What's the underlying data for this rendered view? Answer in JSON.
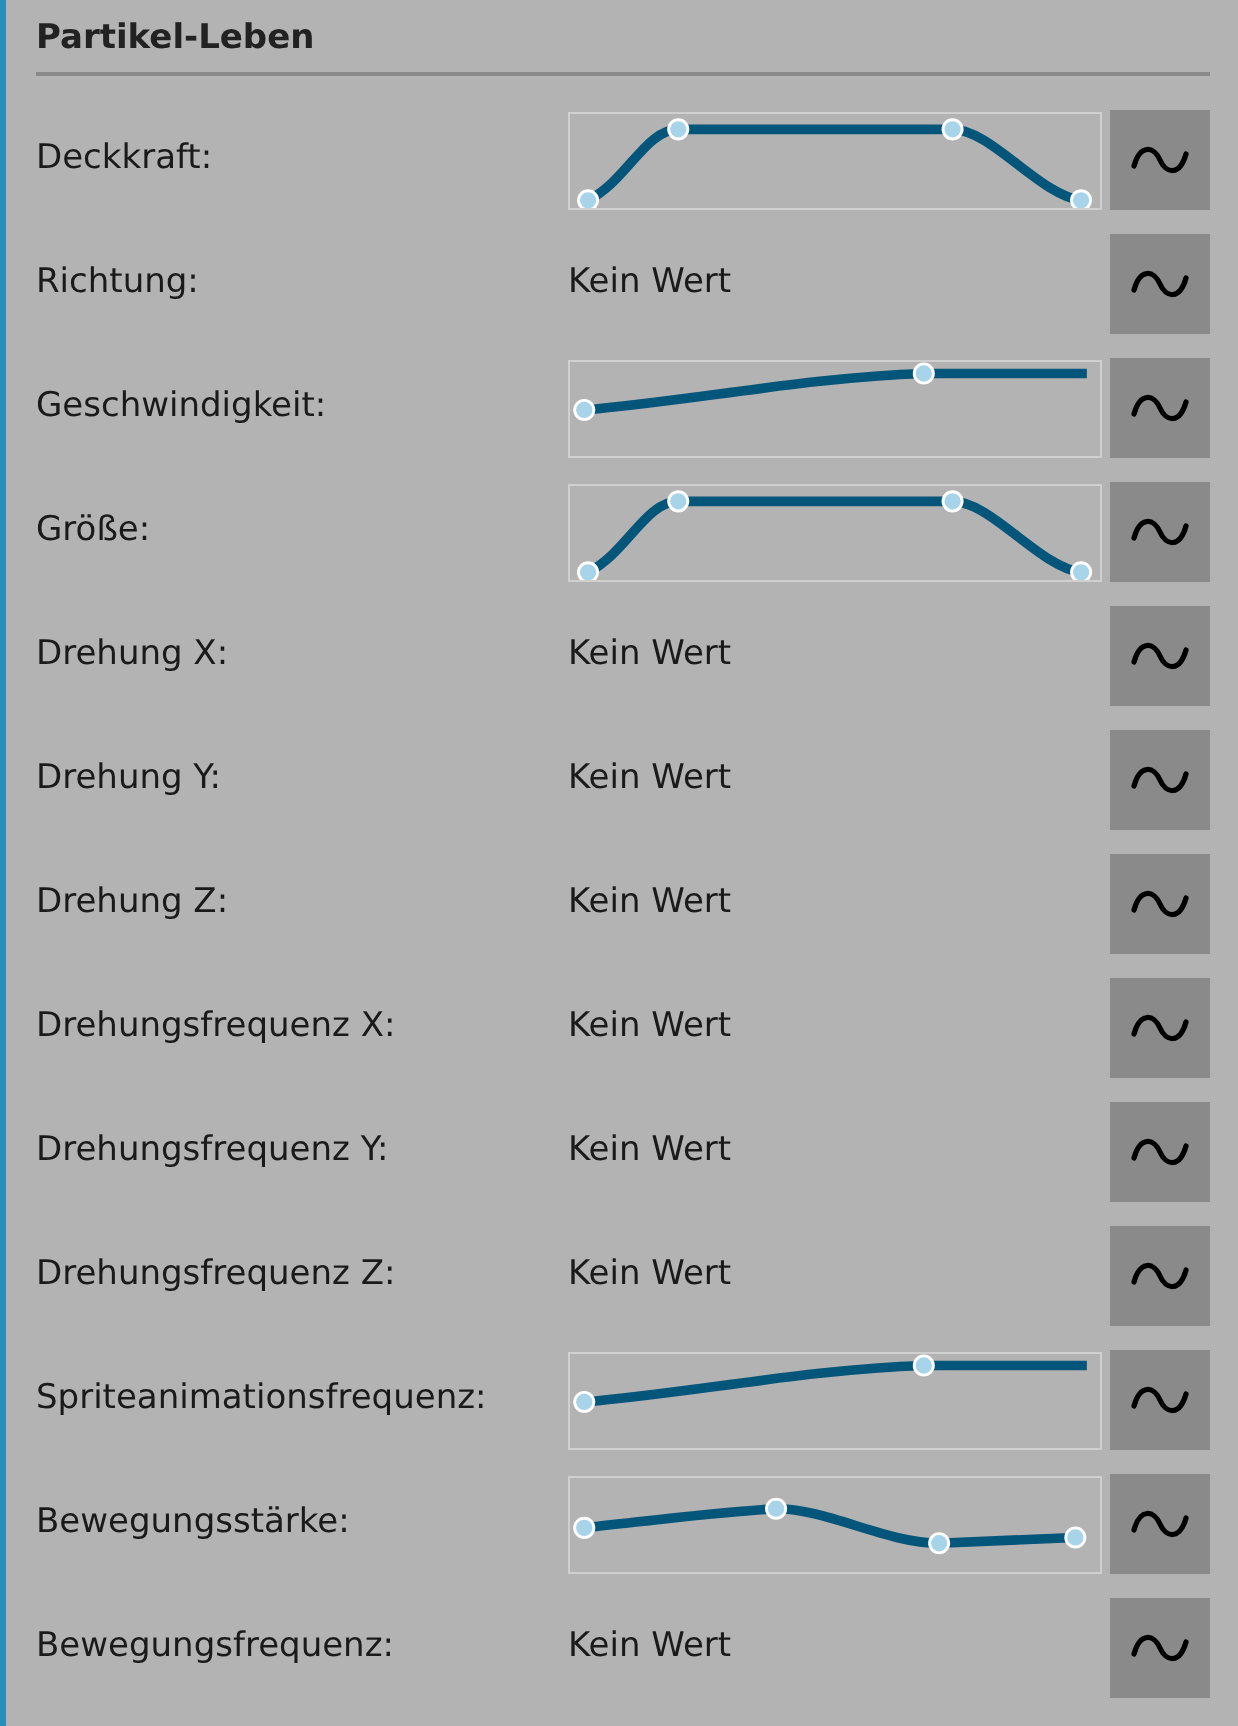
{
  "section": {
    "title": "Partikel-Leben"
  },
  "rows": [
    {
      "label": "Deckkraft:",
      "kind": "plateau"
    },
    {
      "label": "Richtung:",
      "kind": "text",
      "value": "Kein Wert"
    },
    {
      "label": "Geschwindigkeit:",
      "kind": "rise"
    },
    {
      "label": "Größe:",
      "kind": "plateau"
    },
    {
      "label": "Drehung X:",
      "kind": "text",
      "value": "Kein Wert"
    },
    {
      "label": "Drehung Y:",
      "kind": "text",
      "value": "Kein Wert"
    },
    {
      "label": "Drehung Z:",
      "kind": "text",
      "value": "Kein Wert"
    },
    {
      "label": "Drehungsfrequenz X:",
      "kind": "text",
      "value": "Kein Wert"
    },
    {
      "label": "Drehungsfrequenz Y:",
      "kind": "text",
      "value": "Kein Wert"
    },
    {
      "label": "Drehungsfrequenz Z:",
      "kind": "text",
      "value": "Kein Wert"
    },
    {
      "label": "Spriteanimationsfrequenz:",
      "kind": "rise"
    },
    {
      "label": "Bewegungsstärke:",
      "kind": "wave"
    },
    {
      "label": "Bewegungsfrequenz:",
      "kind": "text",
      "value": "Kein Wert"
    }
  ]
}
